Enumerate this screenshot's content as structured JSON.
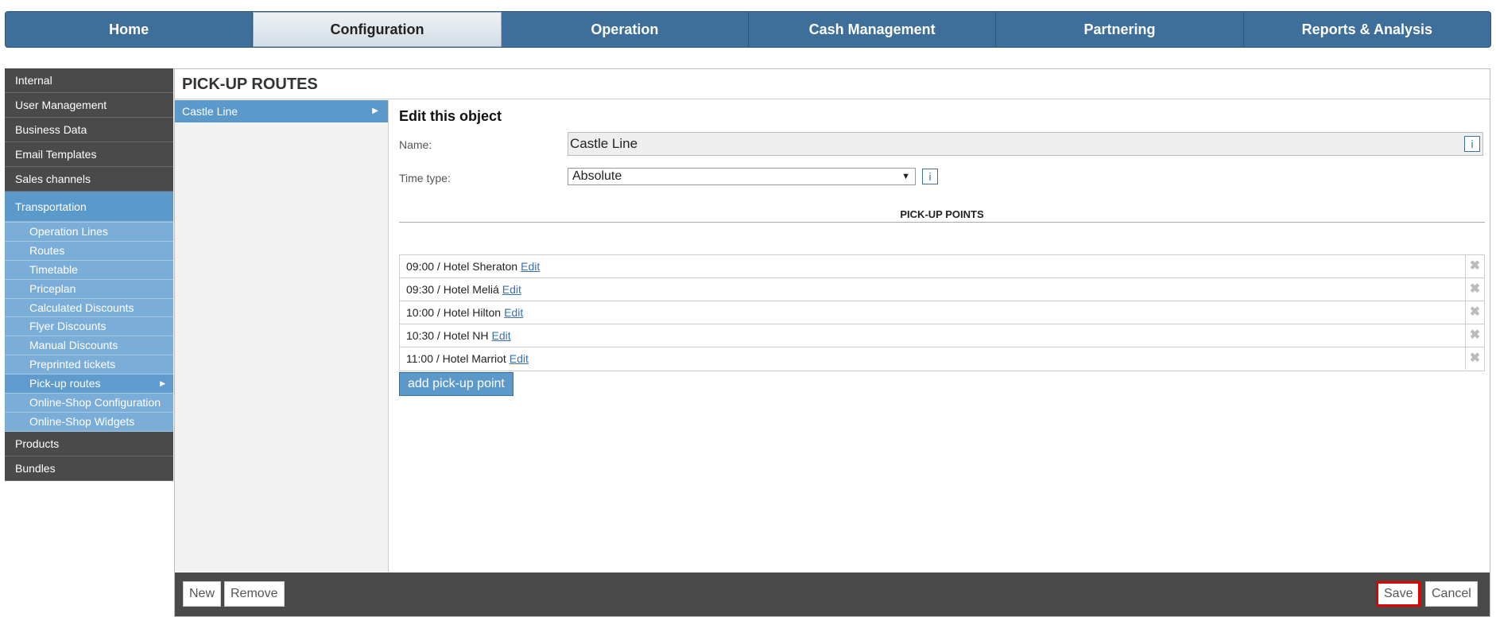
{
  "topnav": {
    "tabs": [
      {
        "label": "Home"
      },
      {
        "label": "Configuration"
      },
      {
        "label": "Operation"
      },
      {
        "label": "Cash Management"
      },
      {
        "label": "Partnering"
      },
      {
        "label": "Reports & Analysis"
      }
    ],
    "active_tab": "Configuration"
  },
  "sidebar": {
    "items_top": [
      "Internal",
      "User Management",
      "Business Data",
      "Email Templates",
      "Sales channels"
    ],
    "active_group": "Transportation",
    "subitems": [
      "Operation Lines",
      "Routes",
      "Timetable",
      "Priceplan",
      "Calculated Discounts",
      "Flyer Discounts",
      "Manual Discounts",
      "Preprinted tickets",
      "Pick-up routes",
      "Online-Shop Configuration",
      "Online-Shop Widgets"
    ],
    "active_sub": "Pick-up routes",
    "items_bottom": [
      "Products",
      "Bundles"
    ]
  },
  "main": {
    "title": "PICK-UP ROUTES",
    "list": [
      {
        "label": "Castle Line"
      }
    ],
    "editor": {
      "heading": "Edit this object",
      "name_label": "Name:",
      "name_value": "Castle Line",
      "time_type_label": "Time type:",
      "time_type_value": "Absolute",
      "info_glyph": "i",
      "section_title": "PICK-UP POINTS",
      "points": [
        {
          "text": "09:00 / Hotel Sheraton",
          "edit": "Edit"
        },
        {
          "text": "09:30 / Hotel Meliá",
          "edit": "Edit"
        },
        {
          "text": "10:00 / Hotel Hilton",
          "edit": "Edit"
        },
        {
          "text": "10:30 / Hotel NH",
          "edit": "Edit"
        },
        {
          "text": "11:00 / Hotel Marriot",
          "edit": "Edit"
        }
      ],
      "add_button": "add pick-up point"
    },
    "bottombar": {
      "new_label": "New",
      "remove_label": "Remove",
      "save_label": "Save",
      "cancel_label": "Cancel"
    }
  },
  "colors": {
    "nav_blue": "#3d6f9a",
    "accent_blue": "#5b99cb",
    "sub_blue": "#7aaed8",
    "dark_gray": "#4a4a4a",
    "highlight_red": "#e00000"
  },
  "icons": {
    "arrow": "arrow-right-icon",
    "delete": "delete-x-icon",
    "info": "info-icon",
    "caret": "chevron-down-icon"
  }
}
